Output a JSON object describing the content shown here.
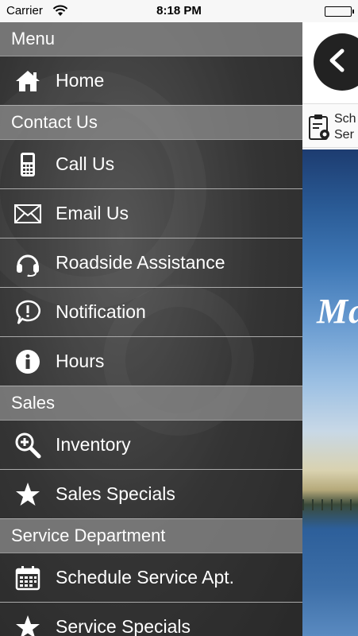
{
  "status_bar": {
    "carrier": "Carrier",
    "time": "8:18 PM"
  },
  "drawer": {
    "sections": [
      {
        "title": "Menu",
        "items": [
          {
            "label": "Home",
            "icon": "home-icon"
          }
        ]
      },
      {
        "title": "Contact Us",
        "items": [
          {
            "label": "Call Us",
            "icon": "phone-icon"
          },
          {
            "label": "Email Us",
            "icon": "envelope-icon"
          },
          {
            "label": "Roadside Assistance",
            "icon": "headset-icon"
          },
          {
            "label": "Notification",
            "icon": "alert-bubble-icon"
          },
          {
            "label": "Hours",
            "icon": "info-icon"
          }
        ]
      },
      {
        "title": "Sales",
        "items": [
          {
            "label": "Inventory",
            "icon": "magnifier-plus-icon"
          },
          {
            "label": "Sales Specials",
            "icon": "star-icon"
          }
        ]
      },
      {
        "title": "Service Department",
        "items": [
          {
            "label": "Schedule Service Apt.",
            "icon": "calendar-icon"
          },
          {
            "label": "Service Specials",
            "icon": "star-icon"
          }
        ]
      }
    ]
  },
  "main": {
    "back_button_icon": "chevron-left-icon",
    "schedule_line1": "Sch",
    "schedule_line2": "Ser",
    "hero_brand": "Ma",
    "colors": {
      "drawer_bg": "#3a3a3a",
      "section_bg": "#828282",
      "hero_sky": "#2a5b96"
    }
  }
}
